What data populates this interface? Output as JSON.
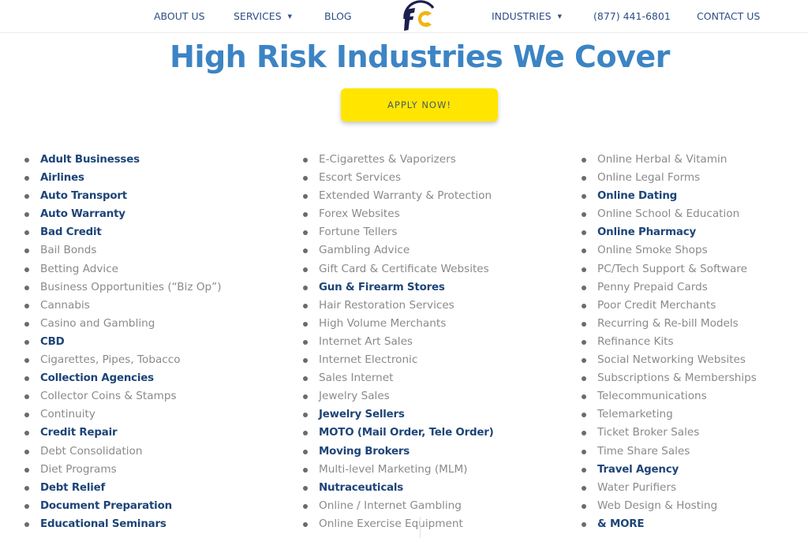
{
  "nav": {
    "items": [
      {
        "label": "ABOUT US",
        "has_dropdown": false
      },
      {
        "label": "SERVICES",
        "has_dropdown": true
      },
      {
        "label": "BLOG",
        "has_dropdown": false
      },
      {
        "label": "INDUSTRIES",
        "has_dropdown": true
      },
      {
        "label": "(877) 441-6801",
        "has_dropdown": false
      },
      {
        "label": "CONTACT US",
        "has_dropdown": false
      }
    ],
    "logo_text": "FC",
    "dropdown_glyph": "▼",
    "colors": {
      "logo_navy": "#1b1f4e",
      "logo_gold": "#f2b411",
      "nav_text": "#2d4f86"
    }
  },
  "main": {
    "title": "High Risk Industries We Cover",
    "apply_button": "APPLY NOW!",
    "colors": {
      "title": "#3c84c4",
      "button": "#ffe500",
      "bold_item": "#1d4578",
      "plain_item": "#8a8a8a"
    },
    "columns": [
      [
        {
          "label": "Adult Businesses",
          "bold": true
        },
        {
          "label": "Airlines",
          "bold": true
        },
        {
          "label": "Auto Transport",
          "bold": true
        },
        {
          "label": "Auto Warranty",
          "bold": true
        },
        {
          "label": "Bad Credit",
          "bold": true
        },
        {
          "label": "Bail Bonds",
          "bold": false
        },
        {
          "label": "Betting Advice",
          "bold": false
        },
        {
          "label": "Business Opportunities (“Biz Op”)",
          "bold": false
        },
        {
          "label": "Cannabis",
          "bold": false
        },
        {
          "label": "Casino and Gambling",
          "bold": false
        },
        {
          "label": "CBD",
          "bold": true
        },
        {
          "label": "Cigarettes, Pipes, Tobacco",
          "bold": false
        },
        {
          "label": "Collection Agencies",
          "bold": true
        },
        {
          "label": "Collector Coins & Stamps",
          "bold": false
        },
        {
          "label": "Continuity",
          "bold": false
        },
        {
          "label": "Credit Repair",
          "bold": true
        },
        {
          "label": "Debt Consolidation",
          "bold": false
        },
        {
          "label": "Diet Programs",
          "bold": false
        },
        {
          "label": "Debt Relief",
          "bold": true
        },
        {
          "label": "Document Preparation",
          "bold": true
        },
        {
          "label": "Educational Seminars",
          "bold": true
        }
      ],
      [
        {
          "label": "E-Cigarettes & Vaporizers",
          "bold": false
        },
        {
          "label": "Escort Services",
          "bold": false
        },
        {
          "label": "Extended Warranty & Protection",
          "bold": false
        },
        {
          "label": "Forex Websites",
          "bold": false
        },
        {
          "label": "Fortune Tellers",
          "bold": false
        },
        {
          "label": "Gambling Advice",
          "bold": false
        },
        {
          "label": "Gift Card & Certificate Websites",
          "bold": false
        },
        {
          "label": "Gun & Firearm Stores",
          "bold": true
        },
        {
          "label": "Hair Restoration Services",
          "bold": false
        },
        {
          "label": "High Volume Merchants",
          "bold": false
        },
        {
          "label": "Internet Art Sales",
          "bold": false
        },
        {
          "label": "Internet Electronic",
          "bold": false
        },
        {
          "label": "Sales Internet",
          "bold": false
        },
        {
          "label": "Jewelry Sales",
          "bold": false
        },
        {
          "label": "Jewelry Sellers",
          "bold": true
        },
        {
          "label": "MOTO (Mail Order, Tele Order)",
          "bold": true
        },
        {
          "label": "Moving Brokers",
          "bold": true
        },
        {
          "label": "Multi-level Marketing (MLM)",
          "bold": false
        },
        {
          "label": "Nutraceuticals",
          "bold": true
        },
        {
          "label": "Online / Internet Gambling",
          "bold": false
        },
        {
          "label": "Online Exercise Equipment",
          "bold": false
        }
      ],
      [
        {
          "label": "Online Herbal & Vitamin",
          "bold": false
        },
        {
          "label": "Online Legal Forms",
          "bold": false
        },
        {
          "label": "Online Dating",
          "bold": true
        },
        {
          "label": "Online School & Education",
          "bold": false
        },
        {
          "label": "Online Pharmacy",
          "bold": true
        },
        {
          "label": "Online Smoke Shops",
          "bold": false
        },
        {
          "label": "PC/Tech Support & Software",
          "bold": false
        },
        {
          "label": "Penny Prepaid Cards",
          "bold": false
        },
        {
          "label": "Poor Credit Merchants",
          "bold": false
        },
        {
          "label": "Recurring & Re-bill Models",
          "bold": false
        },
        {
          "label": "Refinance Kits",
          "bold": false
        },
        {
          "label": "Social Networking Websites",
          "bold": false
        },
        {
          "label": "Subscriptions & Memberships",
          "bold": false
        },
        {
          "label": "Telecommunications",
          "bold": false
        },
        {
          "label": "Telemarketing",
          "bold": false
        },
        {
          "label": "Ticket Broker Sales",
          "bold": false
        },
        {
          "label": "Time Share Sales",
          "bold": false
        },
        {
          "label": "Travel Agency",
          "bold": true
        },
        {
          "label": "Water Purifiers",
          "bold": false
        },
        {
          "label": "Web Design & Hosting",
          "bold": false
        },
        {
          "label": "& MORE",
          "bold": true
        }
      ]
    ]
  }
}
